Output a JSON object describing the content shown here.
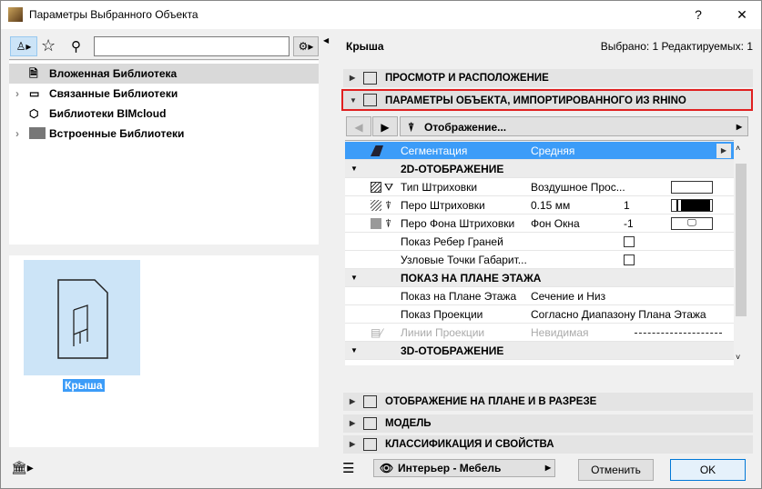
{
  "window": {
    "title": "Параметры Выбранного Объекта",
    "help": "?",
    "close": "✕"
  },
  "left": {
    "search_value": "",
    "tree": [
      {
        "label": "Вложенная Библиотека",
        "selected": true,
        "expandable": false
      },
      {
        "label": "Связанные Библиотеки",
        "expandable": true
      },
      {
        "label": "Библиотеки BIMcloud",
        "expandable": false
      },
      {
        "label": "Встроенные Библиотеки",
        "expandable": true
      }
    ],
    "preview_label": "Крыша"
  },
  "right": {
    "object_name": "Крыша",
    "status": "Выбрано: 1 Редактируемых: 1",
    "sections_top": [
      "ПРОСМОТР И РАСПОЛОЖЕНИЕ",
      "ПАРАМЕТРЫ ОБЪЕКТА, ИМПОРТИРОВАННОГО ИЗ RHINO"
    ],
    "page_dropdown": "Отображение...",
    "rows": {
      "seg": {
        "name": "Сегментация",
        "value": "Средняя"
      },
      "h2d": "2D-ОТОБРАЖЕНИЕ",
      "hatch": {
        "name": "Тип Штриховки",
        "value": "Воздушное Прос..."
      },
      "pen": {
        "name": "Перо Штриховки",
        "value": "0.15 мм",
        "num": "1"
      },
      "bgpen": {
        "name": "Перо Фона Штриховки",
        "value": "Фон Окна",
        "num": "-1"
      },
      "edges": {
        "name": "Показ Ребер Граней"
      },
      "nodes": {
        "name": "Узловые Точки Габарит..."
      },
      "hplan": "ПОКАЗ НА ПЛАНЕ ЭТАЖА",
      "plan": {
        "name": "Показ на Плане Этажа",
        "value": "Сечение и Низ"
      },
      "proj": {
        "name": "Показ Проекции",
        "value": "Согласно Диапазону Плана Этажа"
      },
      "projlines": {
        "name": "Линии Проекции",
        "value": "Невидимая"
      },
      "h3d": "3D-ОТОБРАЖЕНИЕ"
    },
    "sections_bottom": [
      "ОТОБРАЖЕНИЕ НА ПЛАНЕ И В РАЗРЕЗЕ",
      "МОДЕЛЬ",
      "КЛАССИФИКАЦИЯ И СВОЙСТВА"
    ],
    "layer": "Интерьер - Мебель",
    "cancel": "Отменить",
    "ok": "OK"
  },
  "colors": {
    "selection": "#3c9cf8",
    "highlight_border": "#e02020"
  }
}
